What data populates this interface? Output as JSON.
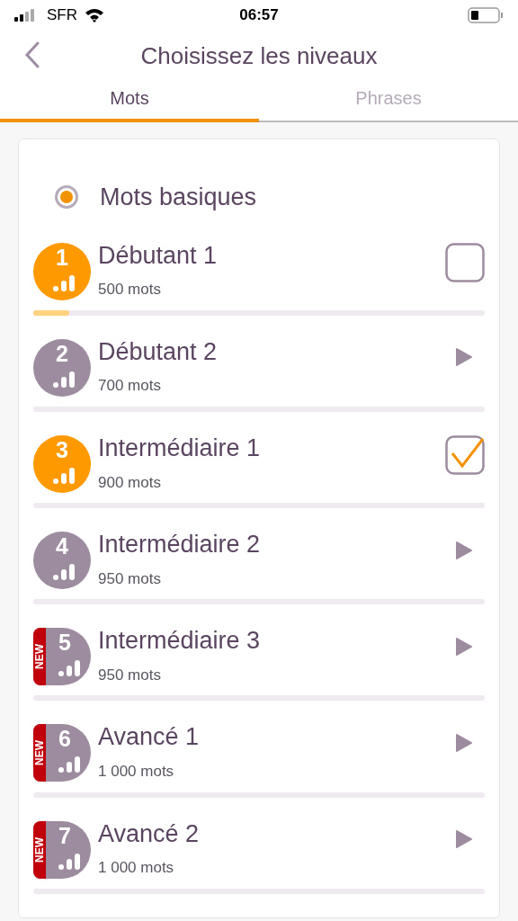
{
  "status_bar": {
    "carrier": "SFR",
    "time": "06:57"
  },
  "header": {
    "title": "Choisissez les niveaux"
  },
  "tabs": [
    {
      "label": "Mots",
      "selected": true
    },
    {
      "label": "Phrases",
      "selected": false
    }
  ],
  "category": {
    "label": "Mots basiques",
    "selected": true
  },
  "levels": [
    {
      "number": "1",
      "name": "Débutant 1",
      "count": "500 mots",
      "kind": "checkbox",
      "checked": false,
      "new": false,
      "level": 0.08
    },
    {
      "number": "2",
      "name": "Débutant 2",
      "count": "700 mots",
      "kind": "play",
      "new": false,
      "level": 0
    },
    {
      "number": "3",
      "name": "Intermédiaire 1",
      "count": "900 mots",
      "kind": "checkbox",
      "checked": true,
      "new": false,
      "level": 0
    },
    {
      "number": "4",
      "name": "Intermédiaire 2",
      "count": "950 mots",
      "kind": "play",
      "new": false,
      "level": 0
    },
    {
      "number": "5",
      "name": "Intermédiaire 3",
      "count": "950 mots",
      "kind": "play",
      "new": true,
      "new_label": "NEW",
      "level": 0
    },
    {
      "number": "6",
      "name": "Avancé 1",
      "count": "1 000 mots",
      "kind": "play",
      "new": true,
      "new_label": "NEW",
      "level": 0
    },
    {
      "number": "7",
      "name": "Avancé 2",
      "count": "1 000 mots",
      "kind": "play",
      "new": true,
      "new_label": "NEW",
      "level": 0
    }
  ]
}
